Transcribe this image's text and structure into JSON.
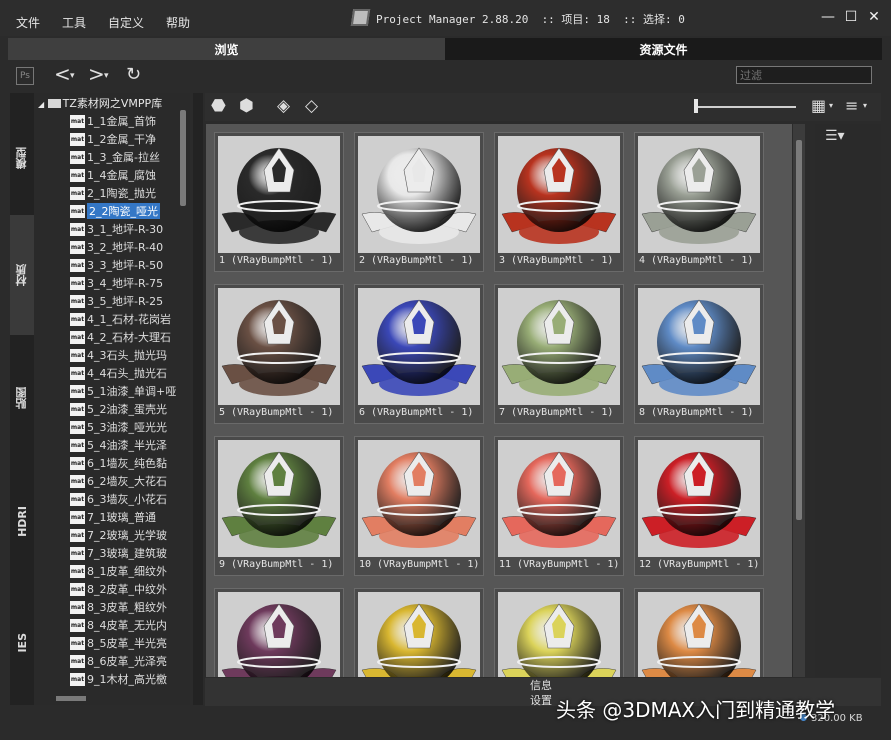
{
  "menu": [
    "文件",
    "工具",
    "自定义",
    "帮助"
  ],
  "app": {
    "title": "Project Manager 2.88.20  :: 项目: 18  :: 选择: 0",
    "icon": "app-logo-icon"
  },
  "window_controls": [
    "—",
    "☐",
    "✕"
  ],
  "tabs": [
    {
      "label": "浏览",
      "active": true
    },
    {
      "label": "资源文件",
      "active": false
    }
  ],
  "toolbar": {
    "ps_label": "Ps",
    "back": "<",
    "forward": ">",
    "refresh": "↻",
    "filter_placeholder": "过滤"
  },
  "side_tabs": [
    "模型",
    "材质",
    "贴图",
    "HDRI",
    "IES"
  ],
  "tree": {
    "root": "TZ素材网之VMPP库",
    "icon_label": "mat",
    "items": [
      "1_1金属_首饰",
      "1_2金属_干净",
      "1_3_金属-拉丝",
      "1_4金属_腐蚀",
      "2_1陶瓷_抛光",
      "2_2陶瓷_哑光",
      "3_1_地坪-R-30",
      "3_2_地坪-R-40",
      "3_3_地坪-R-50",
      "3_4_地坪-R-75",
      "3_5_地坪-R-25",
      "4_1_石材-花岗岩",
      "4_2_石材-大理石",
      "4_3石头_抛光玛",
      "4_4石头_抛光石",
      "5_1油漆_单调+哑",
      "5_2油漆_蛋壳光",
      "5_3油漆_哑光光",
      "5_4油漆_半光泽",
      "6_1墙灰_纯色黏",
      "6_2墙灰_大花石",
      "6_3墙灰_小花石",
      "7_1玻璃_普通",
      "7_2玻璃_光学玻",
      "7_3玻璃_建筑玻",
      "8_1皮革_细纹外",
      "8_2皮革_中纹外",
      "8_3皮革_粗纹外",
      "8_4皮革_无光内",
      "8_5皮革_半光亮",
      "8_6皮革_光泽亮",
      "9_1木材_高光檄"
    ],
    "selected_index": 5
  },
  "grid": {
    "tools": [
      "material-drop-icon",
      "material-group-icon",
      "render-icon",
      "render-all-icon"
    ],
    "view_icons": [
      "grid-view-icon",
      "sort-icon"
    ],
    "items": [
      {
        "caption": "1 (VRayBumpMtl - 1)",
        "color": "#2a2a2a"
      },
      {
        "caption": "2 (VRayBumpMtl - 1)",
        "color": "#e8e8e8"
      },
      {
        "caption": "3 (VRayBumpMtl - 1)",
        "color": "#b8331f"
      },
      {
        "caption": "4 (VRayBumpMtl - 1)",
        "color": "#9aa095"
      },
      {
        "caption": "5 (VRayBumpMtl - 1)",
        "color": "#6a5044"
      },
      {
        "caption": "6 (VRayBumpMtl - 1)",
        "color": "#3b48b8"
      },
      {
        "caption": "7 (VRayBumpMtl - 1)",
        "color": "#98ad76"
      },
      {
        "caption": "8 (VRayBumpMtl - 1)",
        "color": "#5f8bc6"
      },
      {
        "caption": "9 (VRayBumpMtl - 1)",
        "color": "#5f8040"
      },
      {
        "caption": "10 (VRayBumpMtl - 1)",
        "color": "#e27e62"
      },
      {
        "caption": "11 (VRayBumpMtl - 1)",
        "color": "#e5685c"
      },
      {
        "caption": "12 (VRayBumpMtl - 1)",
        "color": "#cc1f26"
      },
      {
        "caption": "",
        "color": "#6e3a5c"
      },
      {
        "caption": "",
        "color": "#d9b731"
      },
      {
        "caption": "",
        "color": "#dbd35a"
      },
      {
        "caption": "",
        "color": "#dd8a45"
      }
    ]
  },
  "right_panel": {
    "icon": "list-view-icon"
  },
  "bottom": {
    "info": "信息",
    "settings": "设置",
    "size": "320.00 KB"
  },
  "watermark": "头条 @3DMAX入门到精通教学"
}
